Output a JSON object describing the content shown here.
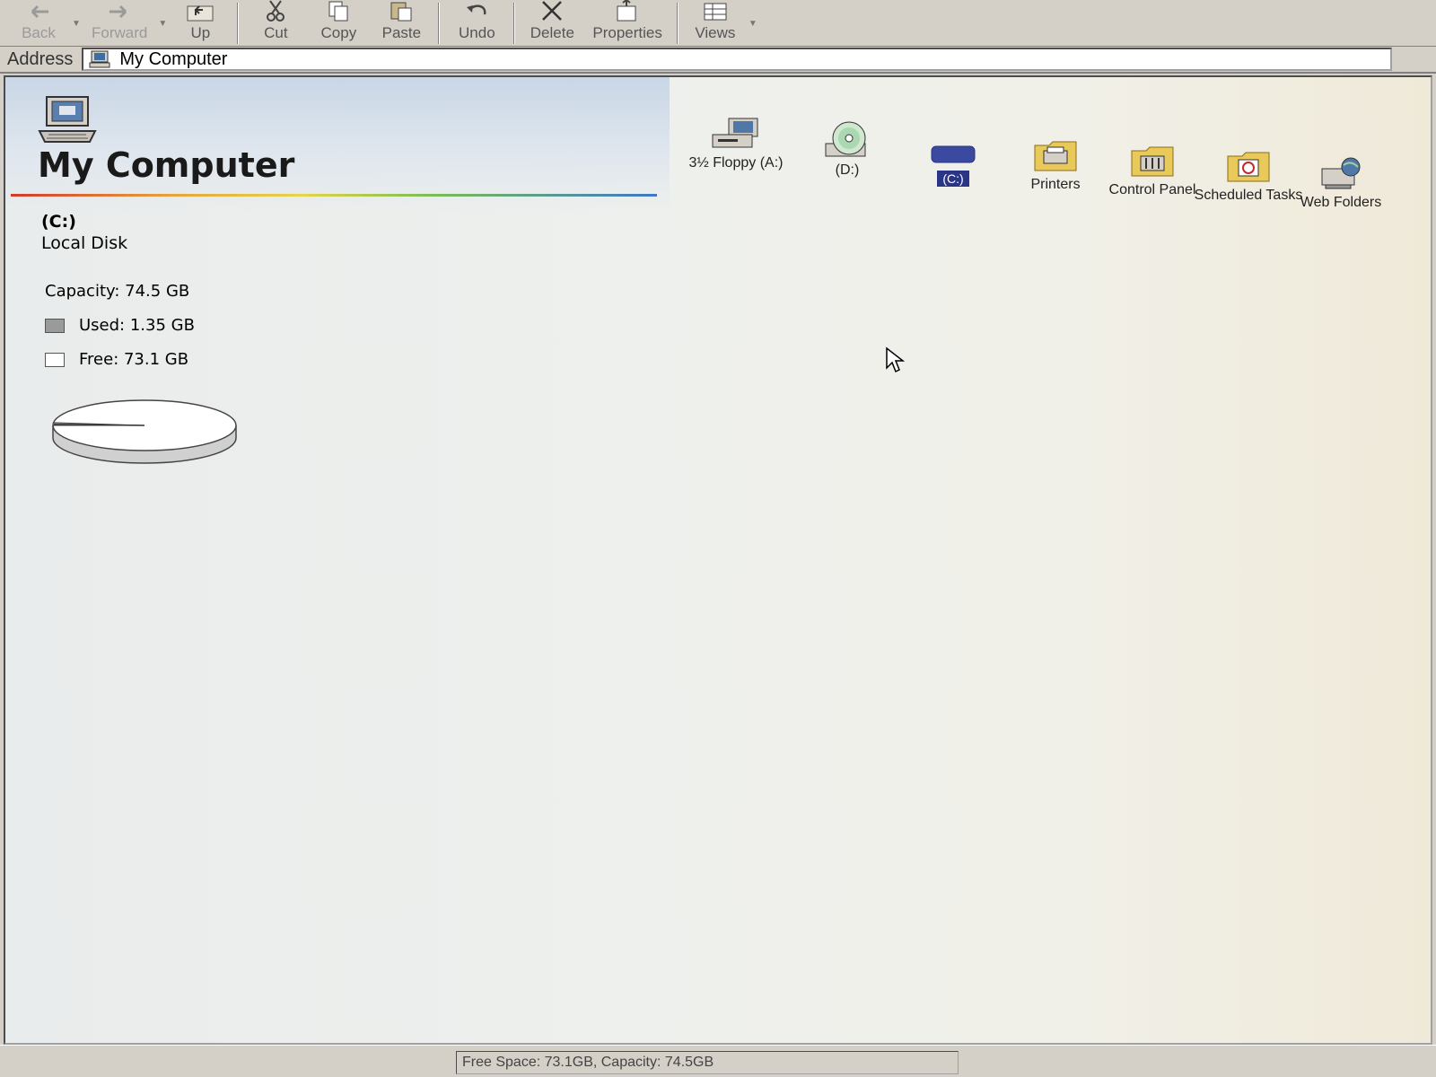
{
  "toolbar": {
    "back": "Back",
    "forward": "Forward",
    "up": "Up",
    "cut": "Cut",
    "copy": "Copy",
    "paste": "Paste",
    "undo": "Undo",
    "delete": "Delete",
    "properties": "Properties",
    "views": "Views"
  },
  "address": {
    "label": "Address",
    "value": "My Computer"
  },
  "page": {
    "title": "My Computer"
  },
  "drive": {
    "letter": "(C:)",
    "type": "Local Disk",
    "capacity": "Capacity: 74.5 GB",
    "used": "Used: 1.35 GB",
    "free": "Free: 73.1 GB",
    "used_fraction": 0.018
  },
  "items": [
    {
      "label": "3½ Floppy (A:)",
      "icon": "floppy-drive-icon"
    },
    {
      "label": "(D:)",
      "icon": "cd-drive-icon"
    },
    {
      "label": "(C:)",
      "icon": "hard-disk-icon",
      "selected": true
    },
    {
      "label": "Printers",
      "icon": "printers-folder-icon"
    },
    {
      "label": "Control Panel",
      "icon": "control-panel-folder-icon"
    },
    {
      "label": "Scheduled Tasks",
      "icon": "scheduled-tasks-folder-icon"
    },
    {
      "label": "Web Folders",
      "icon": "web-folders-icon"
    }
  ],
  "status": {
    "text": "Free Space: 73.1GB,  Capacity: 74.5GB"
  },
  "colors": {
    "selection": "#2b3585",
    "window": "#d4d0c8"
  }
}
